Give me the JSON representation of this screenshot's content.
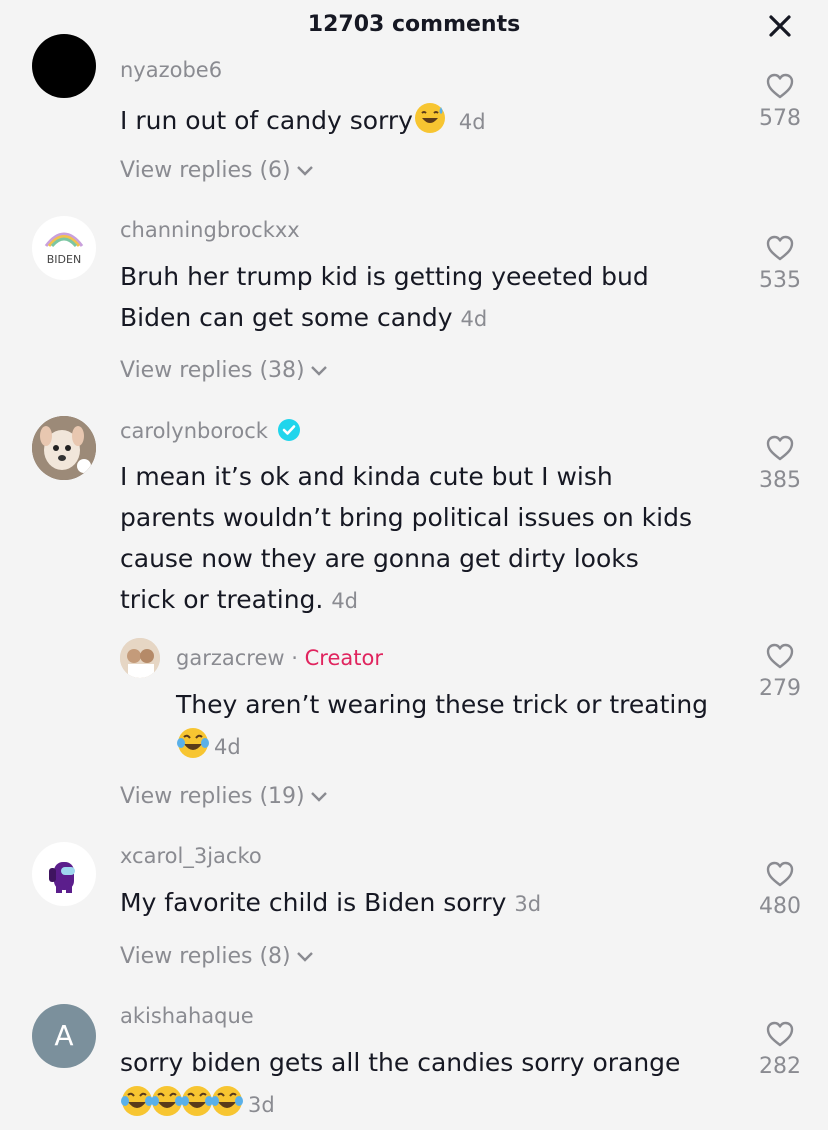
{
  "header": {
    "title": "12703 comments",
    "close_icon": "close-icon"
  },
  "colors": {
    "background": "#f4f4f4",
    "text": "#161823",
    "muted": "#8a8b91",
    "creator": "#e0245e",
    "verified": "#20d5ec"
  },
  "comments": [
    {
      "username": "nyazobe6",
      "text": "I run out of candy sorry",
      "emoji": "sweat-smile",
      "age": "4d",
      "likes": "578",
      "replies": "View replies (6)"
    },
    {
      "username": "channingbrockxx",
      "text_line1": "Bruh her trump kid is getting yeeeted bud",
      "text_line2": "Biden can get some candy",
      "age": "4d",
      "likes": "535",
      "replies": "View replies (38)",
      "avatar_text": "BIDEN"
    },
    {
      "username": "carolynborock",
      "verified": true,
      "text_line1": "I mean it’s ok and kinda cute but I wish",
      "text_line2": "parents wouldn’t bring political issues on kids",
      "text_line3": "cause now they are gonna get dirty looks",
      "text_line4": "trick or treating.",
      "age": "4d",
      "likes": "385",
      "reply": {
        "username": "garzacrew",
        "separator": "·",
        "tag": "Creator",
        "text": "They aren’t wearing these trick or treating",
        "age": "4d",
        "likes": "279"
      },
      "replies": "View replies (19)"
    },
    {
      "username": "xcarol_3jacko",
      "text": "My favorite child is Biden sorry",
      "age": "3d",
      "likes": "480",
      "replies": "View replies (8)"
    },
    {
      "username": "akishahaque",
      "avatar_letter": "A",
      "text": "sorry biden gets all the candies sorry orange",
      "age": "3d",
      "likes": "282"
    }
  ]
}
